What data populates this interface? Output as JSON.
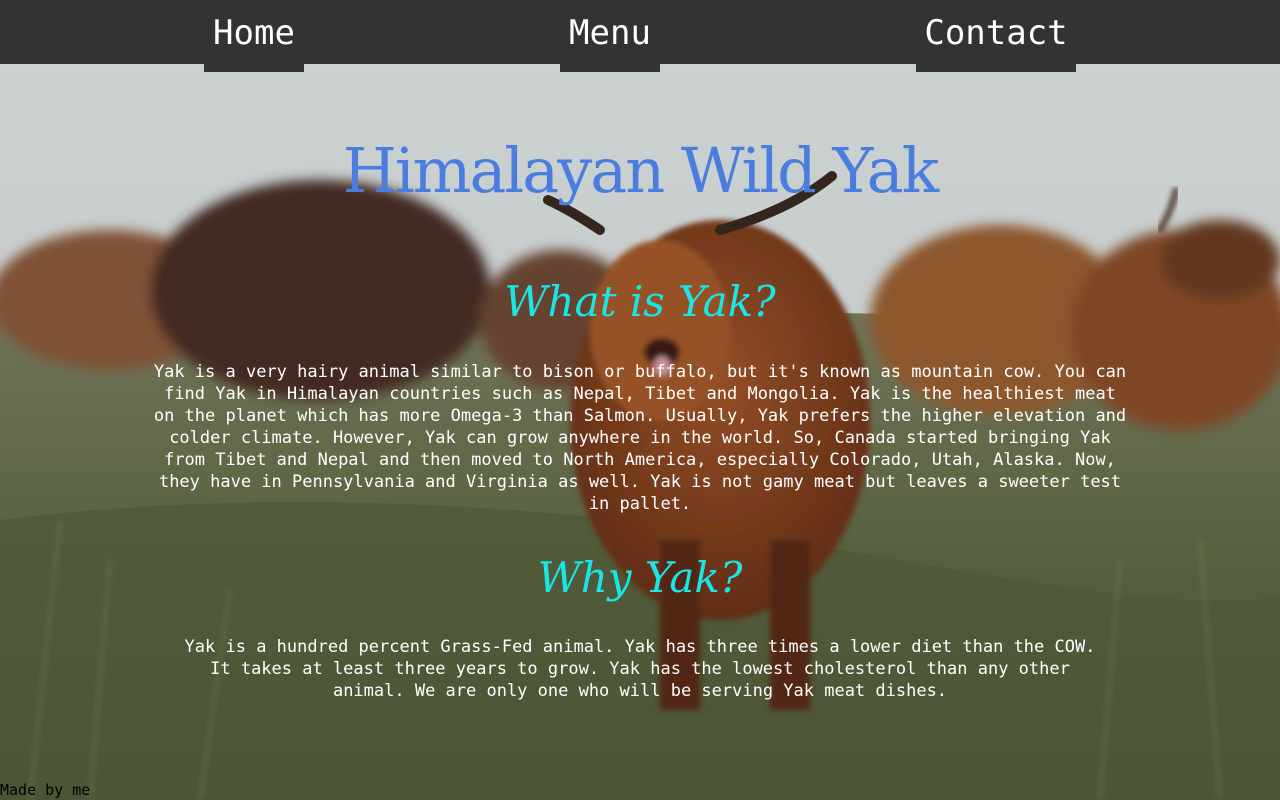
{
  "nav": {
    "home": "Home",
    "menu": "Menu",
    "contact": "Contact"
  },
  "page": {
    "title": "Himalayan Wild Yak"
  },
  "sections": {
    "what": {
      "heading": "What is Yak?",
      "text": "Yak is a very hairy animal similar to bison or buffalo, but it's known as mountain cow. You can find Yak in Himalayan countries such as Nepal, Tibet and Mongolia. Yak is the healthiest meat on the planet which has more Omega-3 than Salmon. Usually, Yak prefers the higher elevation and colder climate. However, Yak can grow anywhere in the world. So, Canada started bringing Yak from Tibet and Nepal and then moved to North America, especially Colorado, Utah, Alaska. Now, they have in Pennsylvania and Virginia as well. Yak is not gamy meat but leaves a sweeter test in pallet."
    },
    "why": {
      "heading": "Why Yak?",
      "text": "Yak is a hundred percent Grass-Fed animal. Yak has three times a lower diet than the COW. It takes at least three years to grow. Yak has the lowest cholesterol than any other animal. We are only one who will be serving Yak meat dishes."
    }
  },
  "footer": {
    "credit": "Made by me"
  },
  "colors": {
    "navbar": "#333333",
    "title": "#4a7ede",
    "heading": "#19e6e6",
    "body_text": "#ffffff"
  }
}
